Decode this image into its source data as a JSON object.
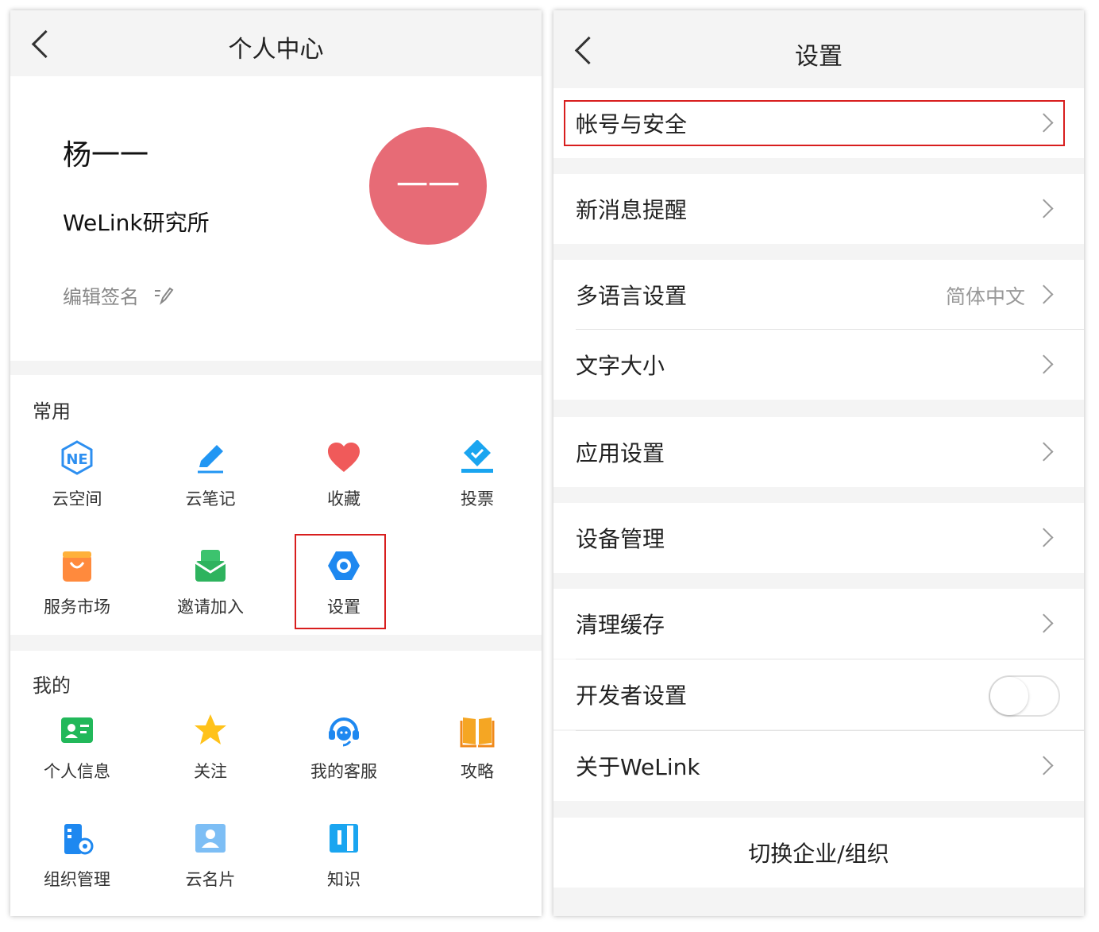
{
  "left": {
    "title": "个人中心",
    "user": {
      "name": "杨一一",
      "avatar_text": "一一",
      "org": "WeLink研究所",
      "edit_signature": "编辑签名"
    },
    "common": {
      "title": "常用",
      "items": [
        {
          "label": "云空间",
          "icon": "cloud-space-icon"
        },
        {
          "label": "云笔记",
          "icon": "pencil-icon"
        },
        {
          "label": "收藏",
          "icon": "heart-icon"
        },
        {
          "label": "投票",
          "icon": "vote-icon"
        },
        {
          "label": "服务市场",
          "icon": "shopping-bag-icon"
        },
        {
          "label": "邀请加入",
          "icon": "invite-envelope-icon"
        },
        {
          "label": "设置",
          "icon": "settings-hexagon-icon"
        }
      ]
    },
    "mine": {
      "title": "我的",
      "items": [
        {
          "label": "个人信息",
          "icon": "id-card-icon"
        },
        {
          "label": "关注",
          "icon": "star-icon"
        },
        {
          "label": "我的客服",
          "icon": "headset-icon"
        },
        {
          "label": "攻略",
          "icon": "book-icon"
        },
        {
          "label": "组织管理",
          "icon": "org-manage-icon"
        },
        {
          "label": "云名片",
          "icon": "contact-card-icon"
        },
        {
          "label": "知识",
          "icon": "knowledge-icon"
        }
      ]
    }
  },
  "right": {
    "title": "设置",
    "rows": [
      {
        "label": "帐号与安全"
      },
      {
        "label": "新消息提醒"
      },
      {
        "label": "多语言设置",
        "value": "简体中文"
      },
      {
        "label": "文字大小"
      },
      {
        "label": "应用设置"
      },
      {
        "label": "设备管理"
      },
      {
        "label": "清理缓存"
      },
      {
        "label": "开发者设置",
        "toggle": false
      },
      {
        "label": "关于WeLink"
      }
    ],
    "switch_org": "切换企业/组织"
  },
  "colors": {
    "highlight": "#d81e1e",
    "avatar": "#e76b76",
    "accent_blue": "#1e88f0"
  }
}
